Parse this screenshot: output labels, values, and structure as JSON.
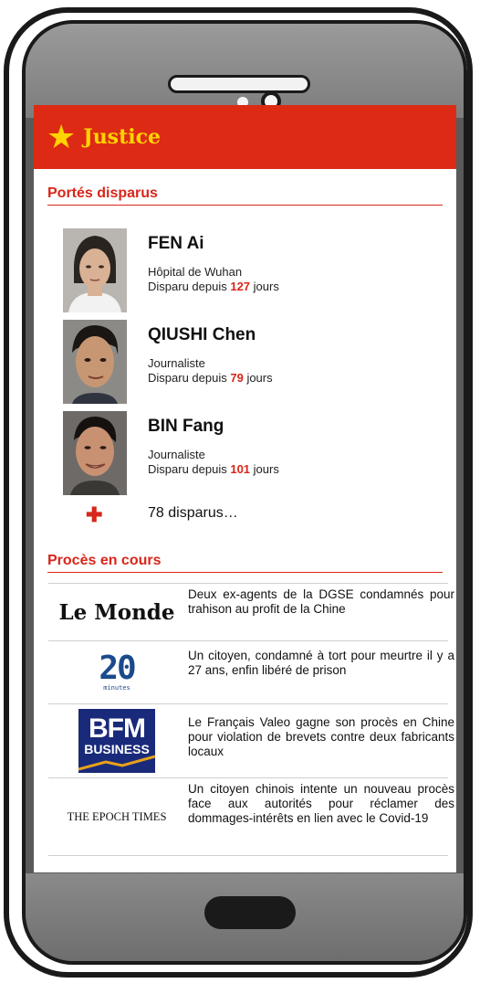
{
  "app": {
    "title": "Justice",
    "star_icon": "star-icon",
    "brand_color": "#dd2a14",
    "accent_color": "#ffd400"
  },
  "missing": {
    "section_title": "Portés disparus",
    "people": [
      {
        "name": "FEN Ai",
        "role": "Hôpital de Wuhan",
        "days_prefix": "Disparu depuis",
        "days": "127",
        "days_suffix": "jours"
      },
      {
        "name": "QIUSHI Chen",
        "role": "Journaliste",
        "days_prefix": "Disparu depuis",
        "days": "79",
        "days_suffix": "jours"
      },
      {
        "name": "BIN Fang",
        "role": "Journaliste",
        "days_prefix": "Disparu depuis",
        "days": "101",
        "days_suffix": "jours"
      }
    ],
    "more_label": "78 disparus…"
  },
  "trials": {
    "section_title": "Procès en cours",
    "items": [
      {
        "source": "Le Monde",
        "text": "Deux ex-agents de la DGSE condamnés pour trahison au profit de la Chine"
      },
      {
        "source": "20 minutes",
        "source_num": "20",
        "source_sub": "minutes",
        "text": "Un citoyen, condamné à tort pour meurtre il y a 27 ans, enfin libéré de prison"
      },
      {
        "source": "BFM BUSINESS",
        "source_top": "BFM",
        "source_bottom": "BUSINESS",
        "text": "Le Français Valeo gagne son procès en Chine pour violation de brevets contre deux fabricants locaux"
      },
      {
        "source": "THE EPOCH TIMES",
        "text": "Un citoyen chinois intente un nouveau procès face aux autorités pour réclamer des dommages-intérêts en lien avec le Covid-19"
      }
    ]
  }
}
